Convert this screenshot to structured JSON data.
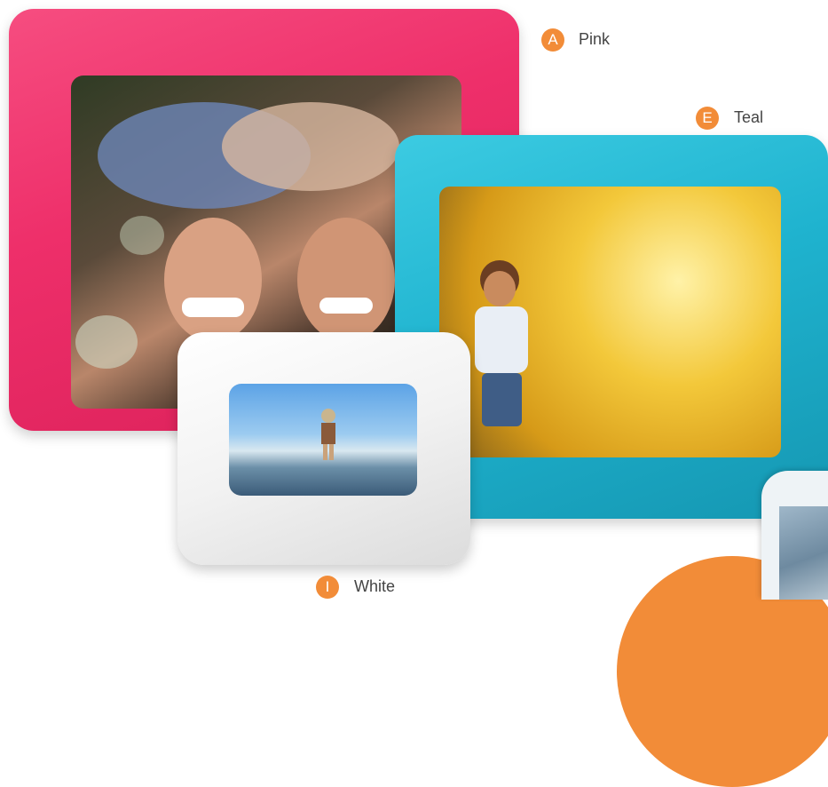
{
  "colors": {
    "pink": "#ee2f6a",
    "teal": "#1fb3cf",
    "white": "#f2f2f2",
    "accent": "#f28c38"
  },
  "options": [
    {
      "letter": "A",
      "name": "Pink"
    },
    {
      "letter": "E",
      "name": "Teal"
    },
    {
      "letter": "I",
      "name": "White"
    }
  ]
}
